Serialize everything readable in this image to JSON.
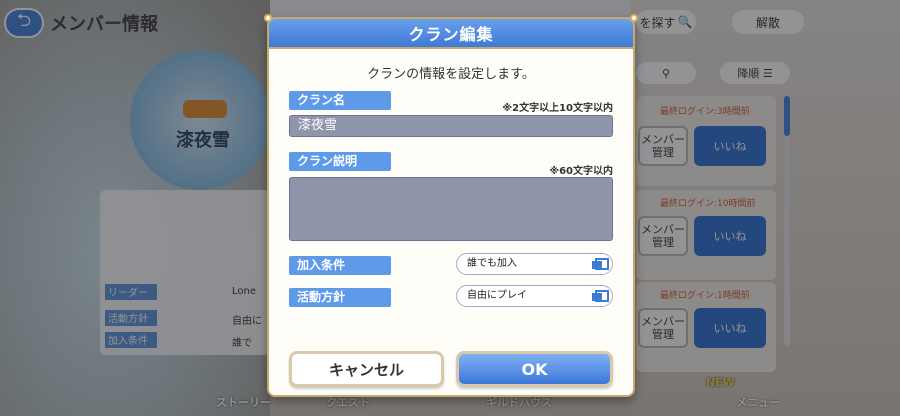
{
  "background": {
    "screen_title": "メンバー情報",
    "search_label": "を探す",
    "dissolve_label": "解散",
    "clan_name": "漆夜雪",
    "sort_label": "降順",
    "info_labels": [
      "リーダー",
      "活動方針",
      "加入条件"
    ],
    "info_values": [
      "Lone",
      "自由に",
      "誰で"
    ],
    "member_rows": [
      {
        "login": "最終ログイン:3時間前",
        "manage": "メンバー管理",
        "like": "いいね"
      },
      {
        "login": "最終ログイン:10時間前",
        "manage": "メンバー管理",
        "like": "いいね"
      },
      {
        "login": "最終ログイン:1時間前",
        "manage": "メンバー管理",
        "like": "いいね"
      }
    ],
    "nav": [
      "ストーリー",
      "クエスト",
      "ギルドハウス",
      "メニュー"
    ],
    "nav_badge": "NEW"
  },
  "modal": {
    "title": "クラン編集",
    "subtitle": "クランの情報を設定します。",
    "name_label": "クラン名",
    "name_note": "※2文字以上10文字以内",
    "name_value": "漆夜雪",
    "desc_label": "クラン説明",
    "desc_note": "※60文字以内",
    "desc_value": "",
    "join_label": "加入条件",
    "join_value": "誰でも加入",
    "policy_label": "活動方針",
    "policy_value": "自由にプレイ",
    "cancel_label": "キャンセル",
    "ok_label": "OK"
  },
  "colors": {
    "accent": "#3d79d6",
    "label_bg": "#5e9ae8",
    "field_bg": "#8f95aa",
    "frame_gold": "#c9a96a"
  }
}
